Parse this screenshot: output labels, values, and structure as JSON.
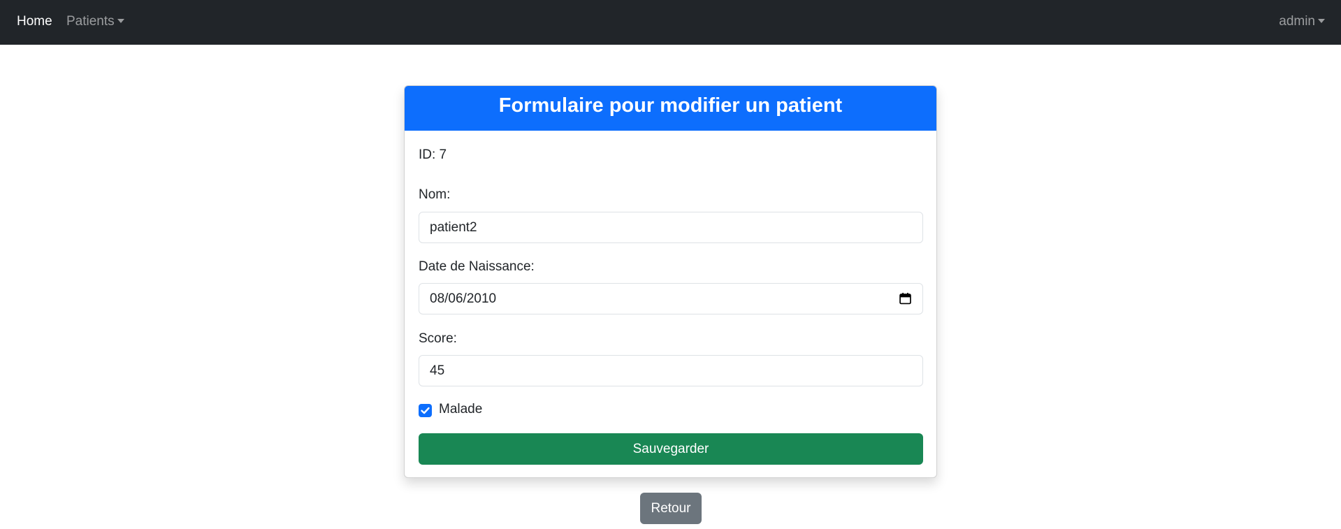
{
  "navbar": {
    "home_label": "Home",
    "patients_label": "Patients",
    "user_label": "admin"
  },
  "form": {
    "title": "Formulaire pour modifier un patient",
    "id_text": "ID: 7",
    "nom_label": "Nom:",
    "nom_value": "patient2",
    "date_label": "Date de Naissance:",
    "date_value": "08/06/2010",
    "score_label": "Score:",
    "score_value": "45",
    "malade_label": "Malade",
    "malade_checked": true,
    "save_label": "Sauvegarder"
  },
  "back_label": "Retour",
  "colors": {
    "navbar_bg": "#212529",
    "header_bg": "#0d6efd",
    "save_bg": "#198754",
    "back_bg": "#6c757d",
    "checkbox": "#0d6efd"
  }
}
